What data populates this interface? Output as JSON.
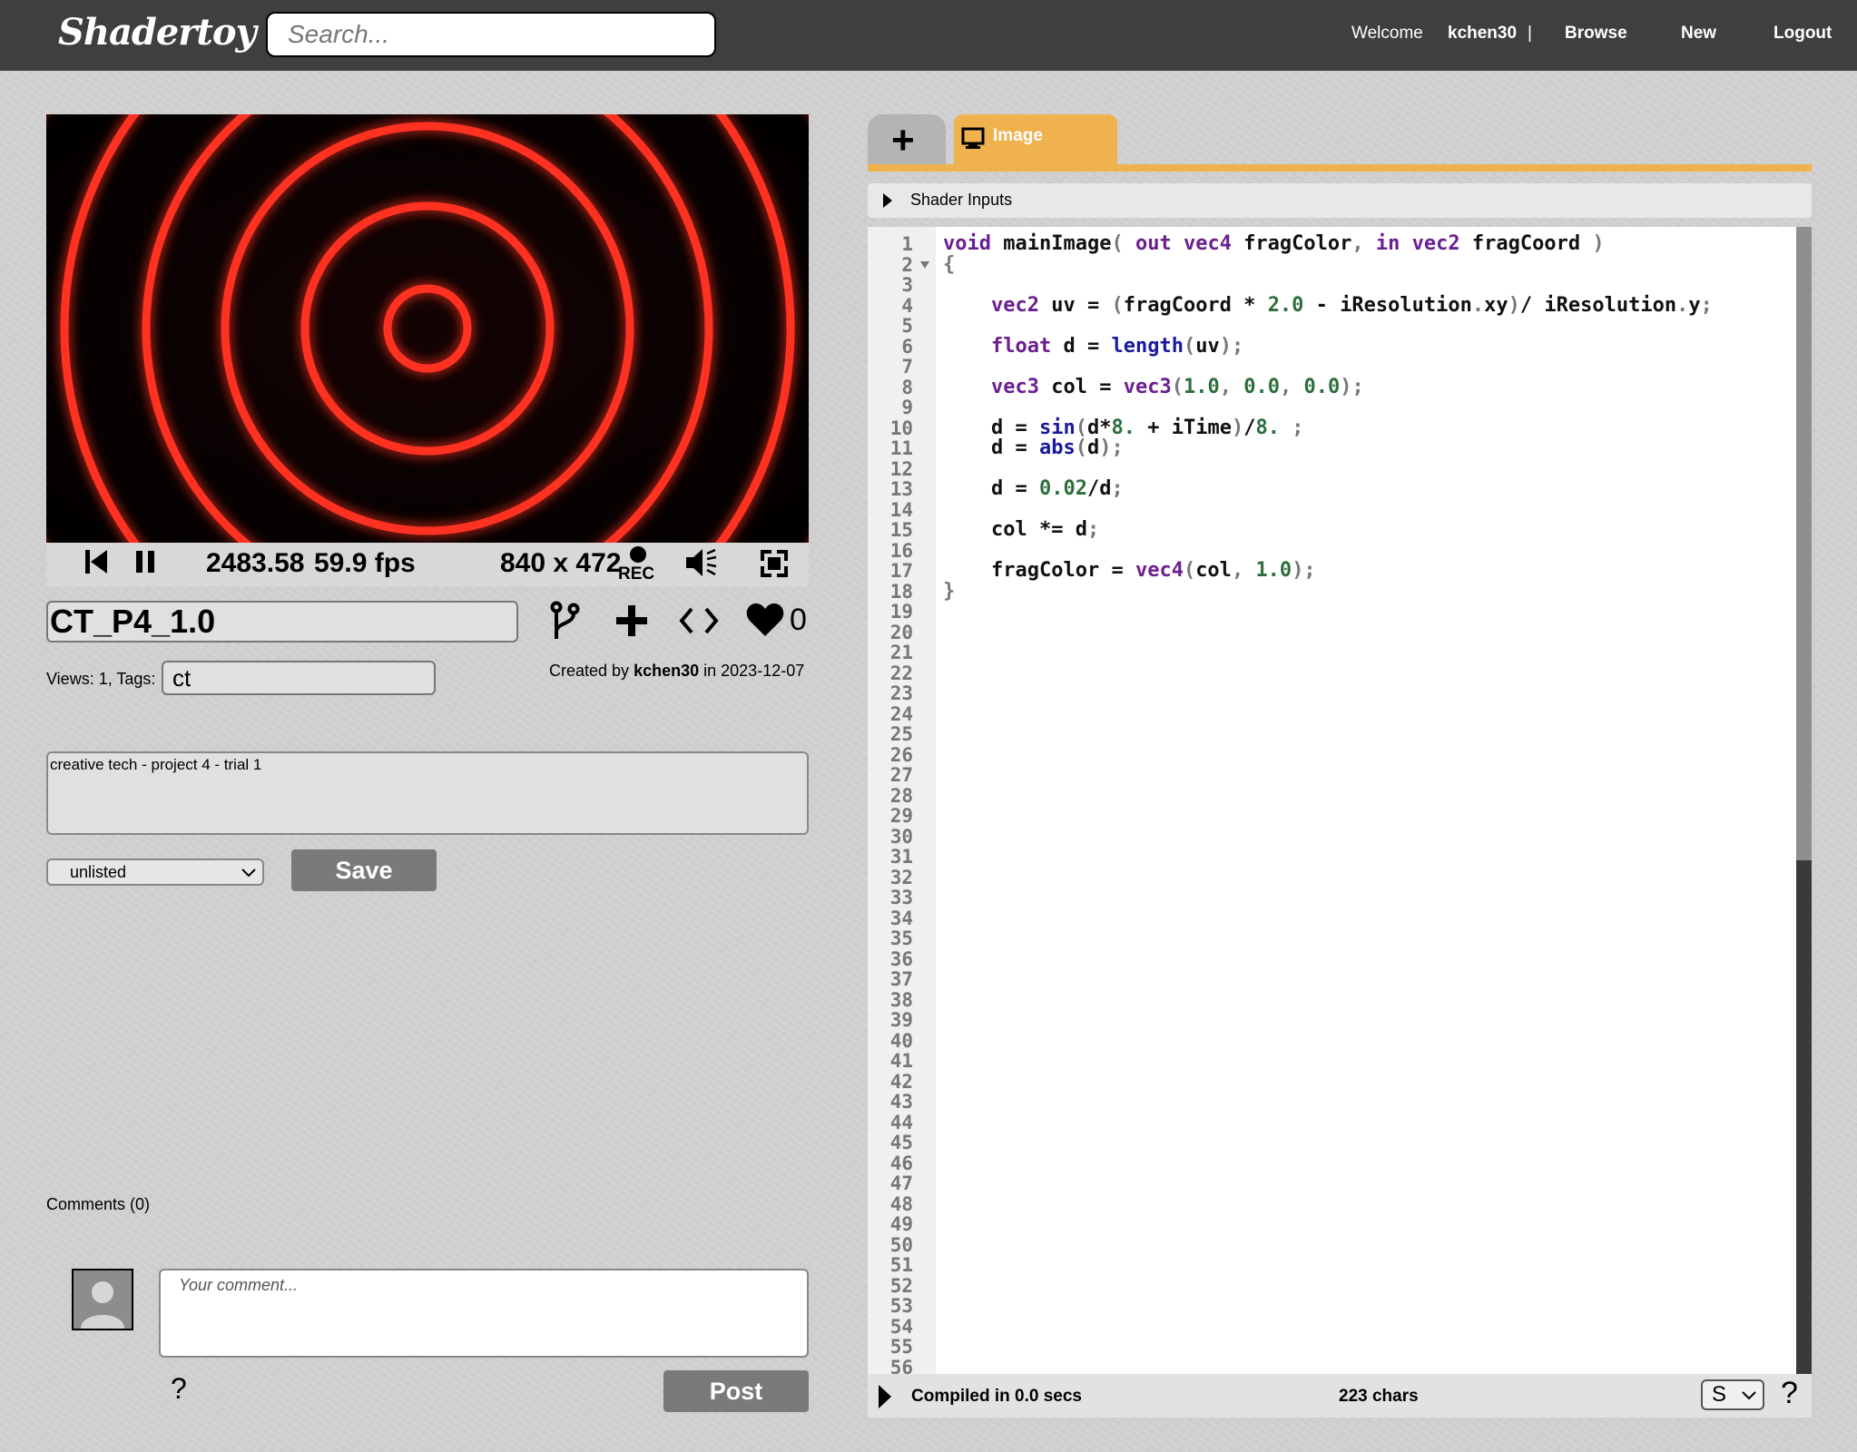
{
  "header": {
    "logo": "Shadertoy",
    "search_placeholder": "Search...",
    "welcome": "Welcome",
    "username": "kchen30",
    "separator": "|",
    "browse": "Browse",
    "new": "New",
    "logout": "Logout"
  },
  "player": {
    "time": "2483.58",
    "fps": "59.9 fps",
    "resolution": "840 x 472",
    "rec": "REC"
  },
  "shader": {
    "title": "CT_P4_1.0",
    "likes": "0",
    "views_tags_label": "Views: 1, Tags:",
    "tags": "ct",
    "created_by_prefix": "Created by",
    "author": "kchen30",
    "created_in": "in 2023-12-07",
    "description": "creative tech - project 4 - trial 1",
    "privacy": "unlisted",
    "save": "Save"
  },
  "comments": {
    "label": "Comments (0)",
    "placeholder": "Your comment...",
    "help": "?",
    "post": "Post"
  },
  "editor": {
    "tab_add": "+",
    "tab_image": "Image",
    "shader_inputs": "Shader Inputs",
    "visible_line_count": 56,
    "code_lines": [
      "void mainImage( out vec4 fragColor, in vec2 fragCoord )",
      "{",
      "",
      "    vec2 uv = (fragCoord * 2.0 - iResolution.xy)/ iResolution.y;",
      "",
      "    float d = length(uv);",
      "",
      "    vec3 col = vec3(1.0, 0.0, 0.0);",
      "",
      "    d = sin(d*8. + iTime)/8. ;",
      "    d = abs(d);",
      "",
      "    d = 0.02/d;",
      "",
      "    col *= d;",
      "",
      "    fragColor = vec4(col, 1.0);",
      "}"
    ],
    "status": "Compiled in 0.0 secs",
    "chars": "223 chars",
    "font_size_option": "S",
    "help": "?"
  },
  "colors": {
    "header_bg": "#3f3f3f",
    "tab_accent": "#f0b24f",
    "keyword": "#6b1f8f",
    "builtin": "#1a1a9c",
    "number": "#2f6e3c",
    "button_gray": "#7a7a7a",
    "ring": "#ff3322"
  }
}
